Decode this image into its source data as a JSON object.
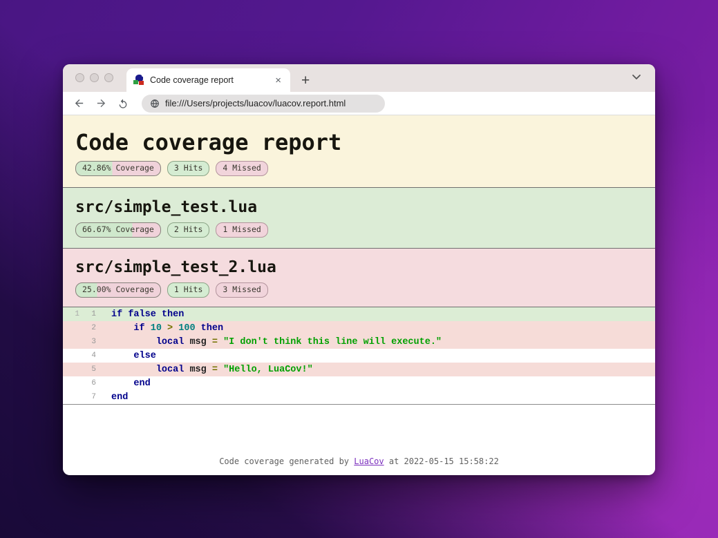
{
  "window": {
    "traffic_lights": [
      "close",
      "minimize",
      "maximize"
    ],
    "tab": {
      "title": "Code coverage report",
      "close_label": "×",
      "favicon": "luacov-favicon"
    },
    "new_tab_label": "+",
    "toolbar": {
      "url": "file:///Users/projects/luacov/luacov.report.html"
    }
  },
  "report": {
    "title": "Code coverage report",
    "summary": {
      "coverage_label": "42.86% Coverage",
      "coverage_pct": 42.86,
      "hits_label": "3 Hits",
      "missed_label": "4 Missed"
    },
    "files": [
      {
        "name": "src/simple_test.lua",
        "coverage_label": "66.67% Coverage",
        "coverage_pct": 66.67,
        "hits_label": "2 Hits",
        "missed_label": "1 Missed"
      },
      {
        "name": "src/simple_test_2.lua",
        "coverage_label": "25.00% Coverage",
        "coverage_pct": 25.0,
        "hits_label": "1 Hits",
        "missed_label": "3 Missed"
      }
    ],
    "code_lines": [
      {
        "hits": "1",
        "number": "1",
        "status": "hit",
        "tokens": [
          [
            "kw",
            "if"
          ],
          [
            "pl",
            " "
          ],
          [
            "kw",
            "false"
          ],
          [
            "pl",
            " "
          ],
          [
            "kw",
            "then"
          ]
        ]
      },
      {
        "hits": "",
        "number": "2",
        "status": "miss",
        "tokens": [
          [
            "pl",
            "    "
          ],
          [
            "kw",
            "if"
          ],
          [
            "pl",
            " "
          ],
          [
            "num",
            "10"
          ],
          [
            "pl",
            " "
          ],
          [
            "op",
            ">"
          ],
          [
            "pl",
            " "
          ],
          [
            "num",
            "100"
          ],
          [
            "pl",
            " "
          ],
          [
            "kw",
            "then"
          ]
        ]
      },
      {
        "hits": "",
        "number": "3",
        "status": "miss",
        "tokens": [
          [
            "pl",
            "        "
          ],
          [
            "kw",
            "local"
          ],
          [
            "pl",
            " "
          ],
          [
            "id",
            "msg"
          ],
          [
            "pl",
            " "
          ],
          [
            "op",
            "="
          ],
          [
            "pl",
            " "
          ],
          [
            "str",
            "\"I don't think this line will execute.\""
          ]
        ]
      },
      {
        "hits": "",
        "number": "4",
        "status": "plain",
        "tokens": [
          [
            "pl",
            "    "
          ],
          [
            "kw",
            "else"
          ]
        ]
      },
      {
        "hits": "",
        "number": "5",
        "status": "miss",
        "tokens": [
          [
            "pl",
            "        "
          ],
          [
            "kw",
            "local"
          ],
          [
            "pl",
            " "
          ],
          [
            "id",
            "msg"
          ],
          [
            "pl",
            " "
          ],
          [
            "op",
            "="
          ],
          [
            "pl",
            " "
          ],
          [
            "str",
            "\"Hello, LuaCov!\""
          ]
        ]
      },
      {
        "hits": "",
        "number": "6",
        "status": "plain",
        "tokens": [
          [
            "pl",
            "    "
          ],
          [
            "kw",
            "end"
          ]
        ]
      },
      {
        "hits": "",
        "number": "7",
        "status": "plain",
        "tokens": [
          [
            "kw",
            "end"
          ]
        ]
      }
    ],
    "footer": {
      "prefix": "Code coverage generated by ",
      "link_label": "LuaCov",
      "suffix": " at 2022-05-15 15:58:22"
    },
    "colors": {
      "header_bg": "#faf4dc",
      "file_hit_bg": "#dcecd6",
      "file_miss_bg": "#f5dcdf",
      "line_hit_bg": "#dcedd5",
      "line_miss_bg": "#f6dcd8",
      "badge_green": "#cfe8cc",
      "badge_pink": "#f0d2da",
      "keyword": "#00008b",
      "number": "#008080",
      "operator": "#727200",
      "string": "#00a000",
      "link": "#7b2fbe"
    }
  }
}
